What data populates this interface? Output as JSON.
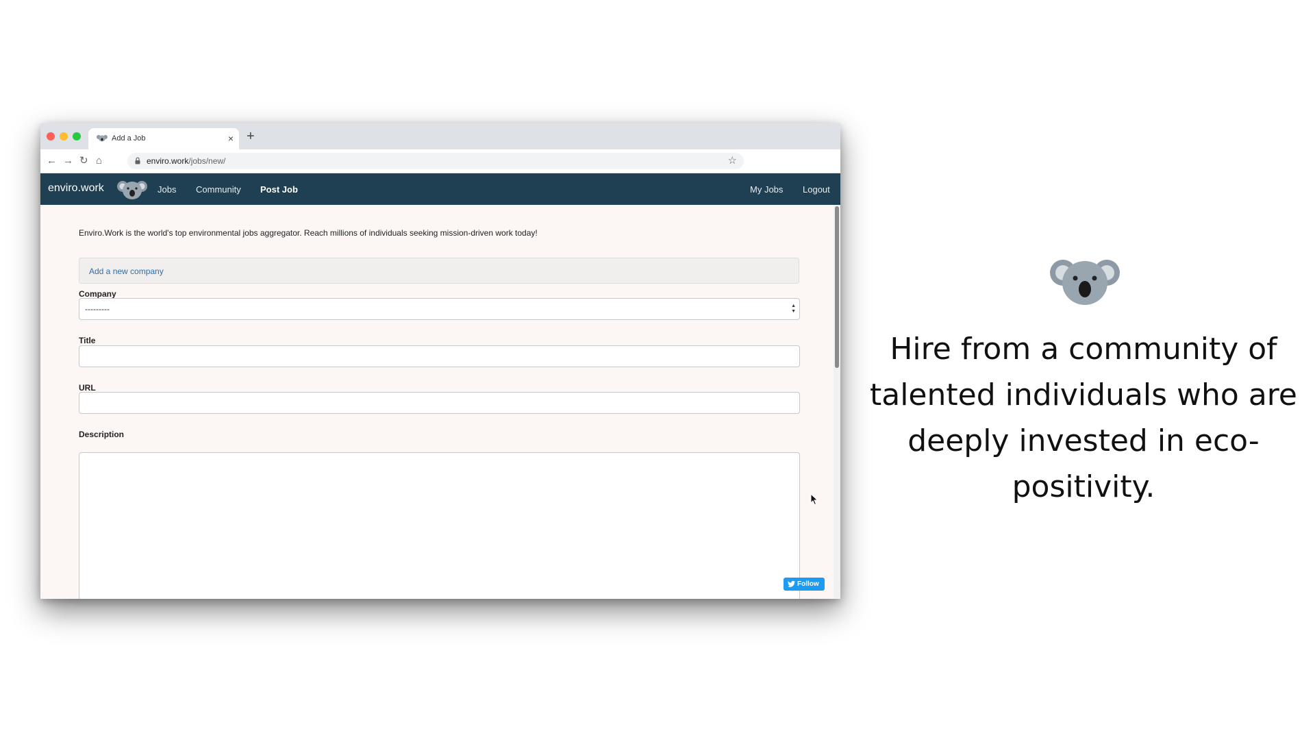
{
  "browser": {
    "tab_title": "Add a Job",
    "new_tab_glyph": "+",
    "close_glyph": "×",
    "url_host": "enviro.work",
    "url_path": "/jobs/new/",
    "icons": [
      "back-icon",
      "forward-icon",
      "reload-icon",
      "home-icon",
      "lock-icon",
      "star-icon"
    ]
  },
  "site_nav": {
    "brand": "enviro.work",
    "links": [
      "Jobs",
      "Community",
      "Post Job"
    ],
    "right_links": [
      "My Jobs",
      "Logout"
    ],
    "active": "Post Job",
    "color": "#1f3f52"
  },
  "content": {
    "intro": "Enviro.Work is the world's top environmental jobs aggregator. Reach millions of individuals seeking mission-driven work today!",
    "add_company_link": "Add a new company",
    "fields": {
      "company_label": "Company",
      "company_value": "---------",
      "title_label": "Title",
      "url_label": "URL",
      "description_label": "Description"
    },
    "follow_button": "Follow"
  },
  "marketing": {
    "tagline": "Hire from a community of talented individuals who are deeply invested in eco-positivity."
  }
}
